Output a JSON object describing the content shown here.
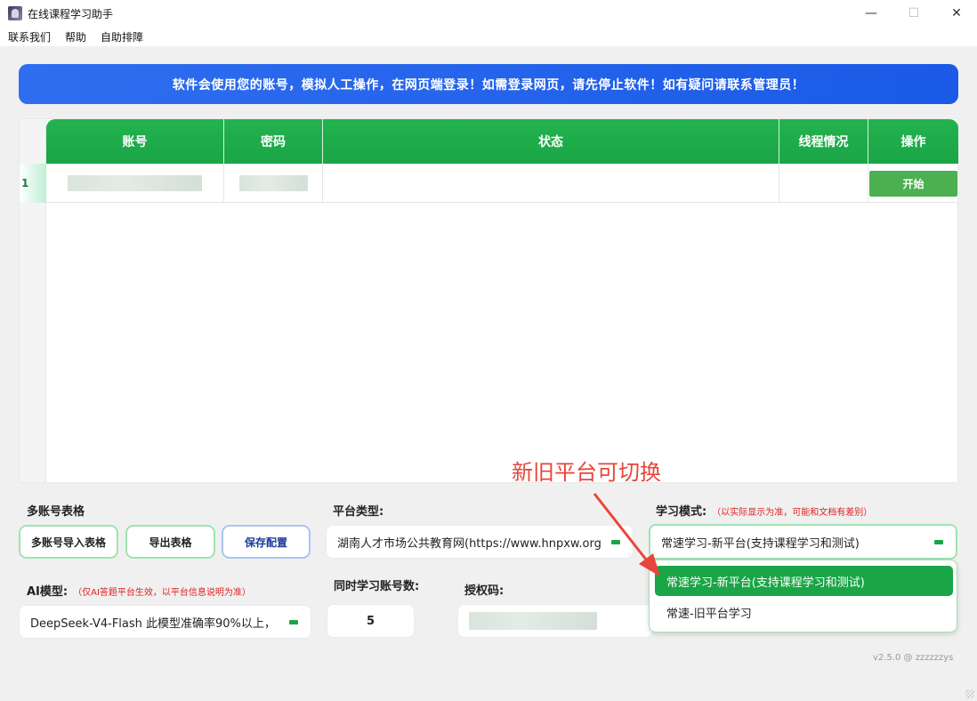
{
  "window": {
    "title": "在线课程学习助手",
    "min": "—",
    "max": "☐",
    "close": "✕"
  },
  "menu": [
    "联系我们",
    "帮助",
    "自助排障"
  ],
  "banner": "软件会使用您的账号，模拟人工操作，在网页端登录！如需登录网页，请先停止软件！如有疑问请联系管理员！",
  "table": {
    "headers": [
      "账号",
      "密码",
      "状态",
      "线程情况",
      "操作"
    ],
    "rows": [
      {
        "num": "1",
        "status": "",
        "thread": "",
        "action": "开始"
      }
    ]
  },
  "multi_table": {
    "label": "多账号表格",
    "import": "多账号导入表格",
    "export": "导出表格",
    "save": "保存配置"
  },
  "platform": {
    "label": "平台类型:",
    "value": "湖南人才市场公共教育网(https://www.hnpxw.org"
  },
  "mode": {
    "label": "学习模式:",
    "hint": "（以实际显示为准，可能和文档有差别）",
    "value": "常速学习-新平台(支持课程学习和测试)",
    "options": [
      "常速学习-新平台(支持课程学习和测试)",
      "常速-旧平台学习"
    ]
  },
  "ai": {
    "label": "AI模型:",
    "hint": "（仅AI答题平台生效，以平台信息说明为准）",
    "value": "DeepSeek-V4-Flash  此模型准确率90%以上，"
  },
  "concurrent": {
    "label": "同时学习账号数:",
    "value": "5"
  },
  "auth": {
    "label": "授权码:"
  },
  "annotation": "新旧平台可切换",
  "version": "v2.5.0 @ zzzzzzys",
  "colors": {
    "primary_green": "#1aa546",
    "banner_blue": "#2f6ef0",
    "annotation_red": "#e8453c"
  }
}
